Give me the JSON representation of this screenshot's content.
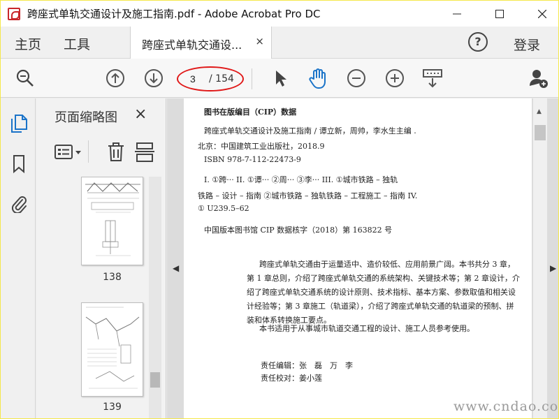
{
  "window": {
    "title": "跨座式单轨交通设计及施工指南.pdf - Adobe Acrobat Pro DC"
  },
  "menu": {
    "home": "主页",
    "tools": "工具",
    "tab_label": "跨座式单轨交通设...",
    "tab_close": "×",
    "help": "?",
    "login": "登录"
  },
  "toolbar": {
    "current_page": "3",
    "total_pages": "/ 154"
  },
  "panel": {
    "title": "页面缩略图",
    "close": "×",
    "thumbnails": [
      {
        "label": "138"
      },
      {
        "label": "139"
      }
    ]
  },
  "document": {
    "cip_lines": [
      "图书在版编目（CIP）数据",
      "跨座式单轨交通设计及施工指南 / 谭立新，周帅，李水生主编 .",
      "北京：中国建筑工业出版社，2018.9",
      "ISBN 978-7-112-22473-9",
      "I. ①跨···  II. ①谭···  ②周···  ③李···    III. ①城市铁路 – 独轨",
      "铁路 – 设计 – 指南  ②城市铁路 – 独轨铁路 – 工程施工 – 指南    IV.",
      "① U239.5–62",
      "中国版本图书馆 CIP 数据核字（2018）第 163822 号"
    ],
    "summary_lines": [
      "跨座式单轨交通由于运量适中、造价较低、应用前景广阔。本书共分 3 章，",
      "第 1 章总则，介绍了跨座式单轨交通的系统架构、关键技术等；第 2 章设计，介",
      "绍了跨座式单轨交通系统的设计原则、技术指标、基本方案、参数取值和相关设",
      "计经验等；第 3 章施工（轨道梁），介绍了跨座式单轨交通的轨道梁的预制、拼",
      "装和体系转换施工要点。",
      "本书适用于从事城市轨道交通工程的设计、施工人员参考使用。"
    ],
    "editor_line": "责任编辑：张　磊　万　李",
    "proof_line": "责任校对：姜小莲"
  },
  "watermark": "www.cndao.com",
  "colors": {
    "frame": "#f5e84a",
    "accent_blue": "#1a73c8",
    "highlight_red": "#e01818"
  }
}
